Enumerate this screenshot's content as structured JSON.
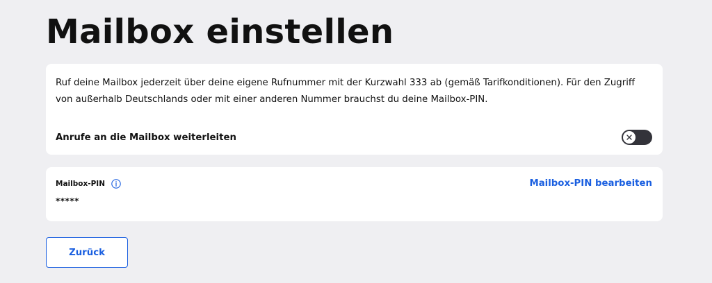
{
  "page": {
    "title": "Mailbox einstellen"
  },
  "info_card": {
    "description": "Ruf deine Mailbox jederzeit über deine eigene Rufnummer mit der Kurzwahl 333 ab (gemäß Tarifkonditionen). Für den Zugriff von außerhalb Deutschlands oder mit einer anderen Nummer brauchst du deine Mailbox-PIN.",
    "forward_label": "Anrufe an die Mailbox weiterleiten",
    "forward_enabled": false
  },
  "pin_card": {
    "label": "Mailbox-PIN",
    "value": "*****",
    "edit_link": "Mailbox-PIN bearbeiten"
  },
  "actions": {
    "back_label": "Zurück"
  },
  "colors": {
    "background": "#efeff2",
    "accent": "#1a5fe0",
    "toggle_off": "#33333a"
  },
  "icons": {
    "info": "info-circle-icon",
    "toggle_off": "close-icon"
  }
}
